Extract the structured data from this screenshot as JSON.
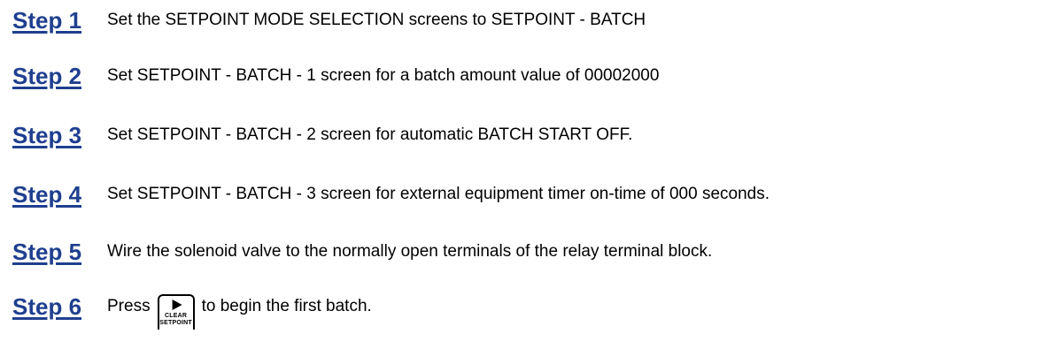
{
  "steps": [
    {
      "label": "Step 1",
      "text": "Set the SETPOINT MODE SELECTION screens to SETPOINT - BATCH"
    },
    {
      "label": "Step 2",
      "text": "Set SETPOINT - BATCH - 1 screen for a batch amount value of 00002000"
    },
    {
      "label": "Step 3",
      "text": "Set SETPOINT - BATCH - 2 screen for automatic BATCH START OFF."
    },
    {
      "label": "Step 4",
      "text": "Set SETPOINT - BATCH - 3 screen for external equipment timer on-time of 000 seconds."
    },
    {
      "label": "Step 5",
      "text": "Wire the solenoid valve to the normally open terminals of the relay terminal block."
    },
    {
      "label": "Step 6",
      "text_before": "Press",
      "key": {
        "icon": "play-arrow-icon",
        "line1": "CLEAR",
        "line2": "SETPOINT"
      },
      "text_after": "to begin the first batch."
    }
  ],
  "colors": {
    "step_label": "#1f3f8f",
    "body_text": "#000000"
  }
}
